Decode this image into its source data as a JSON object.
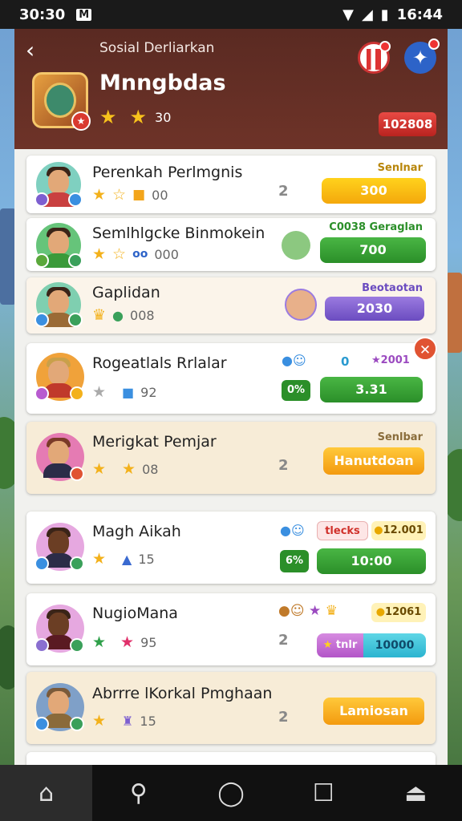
{
  "status_bar": {
    "time_left": "30:30",
    "badge": "M",
    "time_right": "16:44"
  },
  "header": {
    "subtitle": "Sosial Derliarkan",
    "title": "Mnngbdas",
    "rating": "30",
    "pill": "102808"
  },
  "rows": [
    {
      "name": "Perenkah Perlmgnis",
      "stat": "00",
      "rank": "2",
      "label": "Senlnar",
      "button": "300",
      "label_color": "#b8860b"
    },
    {
      "name": "Semlhlgcke Binmokein",
      "stat": "000",
      "label": "C0038 Geraglan",
      "button": "700",
      "label_color": "#2b8f29"
    },
    {
      "name": "Gaplidan",
      "stat": "008",
      "label": "Beotaotan",
      "button": "2030",
      "label_color": "#6b4cc0"
    },
    {
      "name": "Rogeatlals Rrlalar",
      "stat": "92",
      "small_a": "0",
      "small_b": "2001",
      "tag": "0%",
      "button": "3.31"
    },
    {
      "name": "Merigkat Pemjar",
      "stat": "08",
      "rank": "2",
      "label": "Senlbar",
      "button": "Hanutdoan",
      "label_color": "#8a6d3b"
    },
    {
      "name": "Magh Aikah",
      "stat": "15",
      "tag_red": "tlecks",
      "coin": "12.001",
      "tag": "6%",
      "button": "10:00"
    },
    {
      "name": "NugioMana",
      "stat": "95",
      "rank": "2",
      "coin": "12061",
      "split_a": "tnlr",
      "split_b": "10000"
    },
    {
      "name": "Abrrre lKorkal Pmghaan",
      "stat": "15",
      "rank": "2",
      "button": "Lamiosan"
    }
  ],
  "colors": {
    "header_bg": "#5a2a22",
    "gold": "#f4a80c",
    "green": "#2b8f29",
    "purple": "#6b4cc0"
  },
  "nav": [
    "home-icon",
    "search-icon",
    "circle-icon",
    "square-icon",
    "profile-icon"
  ]
}
